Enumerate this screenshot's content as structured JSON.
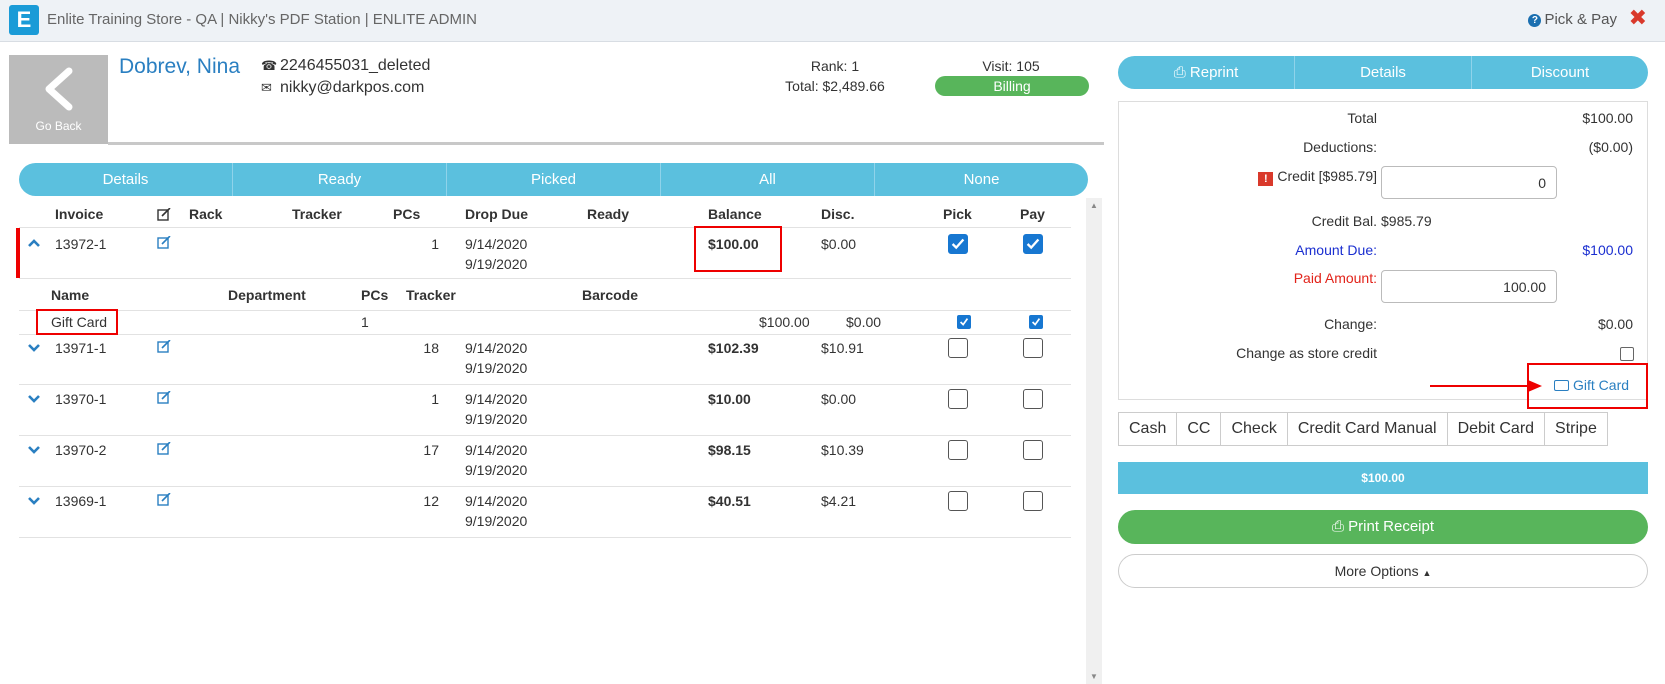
{
  "titlebar": {
    "logo": "E",
    "title": "Enlite Training Store - QA | Nikky's PDF Station | ENLITE ADMIN",
    "pick_pay": "Pick & Pay",
    "close": "✖"
  },
  "customer": {
    "go_back": "Go Back",
    "name": "Dobrev, Nina",
    "phone": "2246455031_deleted",
    "email": "nikky@darkpos.com",
    "rank": "Rank: 1",
    "total": "Total: $2,489.66",
    "visit": "Visit: 105",
    "status": "Billing"
  },
  "filters": [
    "Details",
    "Ready",
    "Picked",
    "All",
    "None"
  ],
  "table": {
    "headers": {
      "invoice": "Invoice",
      "rack": "Rack",
      "tracker": "Tracker",
      "pcs": "PCs",
      "drop_due": "Drop Due",
      "ready": "Ready",
      "balance": "Balance",
      "disc": "Disc.",
      "pick": "Pick",
      "pay": "Pay"
    },
    "rows": [
      {
        "invoice": "13972-1",
        "pcs": "1",
        "drop": "9/14/2020",
        "due": "9/19/2020",
        "balance": "$100.00",
        "disc": "$0.00",
        "pick": true,
        "pay": true,
        "expanded": true
      },
      {
        "invoice": "13971-1",
        "pcs": "18",
        "drop": "9/14/2020",
        "due": "9/19/2020",
        "balance": "$102.39",
        "disc": "$10.91",
        "pick": false,
        "pay": false
      },
      {
        "invoice": "13970-1",
        "pcs": "1",
        "drop": "9/14/2020",
        "due": "9/19/2020",
        "balance": "$10.00",
        "disc": "$0.00",
        "pick": false,
        "pay": false
      },
      {
        "invoice": "13970-2",
        "pcs": "17",
        "drop": "9/14/2020",
        "due": "9/19/2020",
        "balance": "$98.15",
        "disc": "$10.39",
        "pick": false,
        "pay": false
      },
      {
        "invoice": "13969-1",
        "pcs": "12",
        "drop": "9/14/2020",
        "due": "9/19/2020",
        "balance": "$40.51",
        "disc": "$4.21",
        "pick": false,
        "pay": false
      }
    ],
    "detail_headers": {
      "name": "Name",
      "department": "Department",
      "pcs": "PCs",
      "tracker": "Tracker",
      "barcode": "Barcode"
    },
    "detail_row": {
      "name": "Gift Card",
      "pcs": "1",
      "amount": "$100.00",
      "disc": "$0.00",
      "pick": true,
      "pay": true
    }
  },
  "payment": {
    "buttons": {
      "reprint": "Reprint",
      "details": "Details",
      "discount": "Discount"
    },
    "total_label": "Total",
    "total_value": "$100.00",
    "deductions_label": "Deductions:",
    "deductions_value": "($0.00)",
    "credit_label": "Credit [$985.79]",
    "credit_input": "0",
    "credit_bal_label": "Credit Bal.",
    "credit_bal_value": "$985.79",
    "amount_due_label": "Amount Due:",
    "amount_due_value": "$100.00",
    "paid_label": "Paid Amount:",
    "paid_input": "100.00",
    "change_label": "Change:",
    "change_value": "$0.00",
    "store_credit_label": "Change as store credit",
    "gift_card": "Gift Card",
    "methods": [
      "Cash",
      "CC",
      "Check",
      "Credit Card Manual",
      "Debit Card",
      "Stripe"
    ],
    "amount_bar": "$100.00",
    "print_receipt": "Print Receipt",
    "more_options": "More Options"
  },
  "colors": {
    "accent": "#5bc0de",
    "success": "#58b55b",
    "link": "#2a7fc1",
    "highlight": "#ee0000",
    "checkbox": "#1777d1"
  }
}
